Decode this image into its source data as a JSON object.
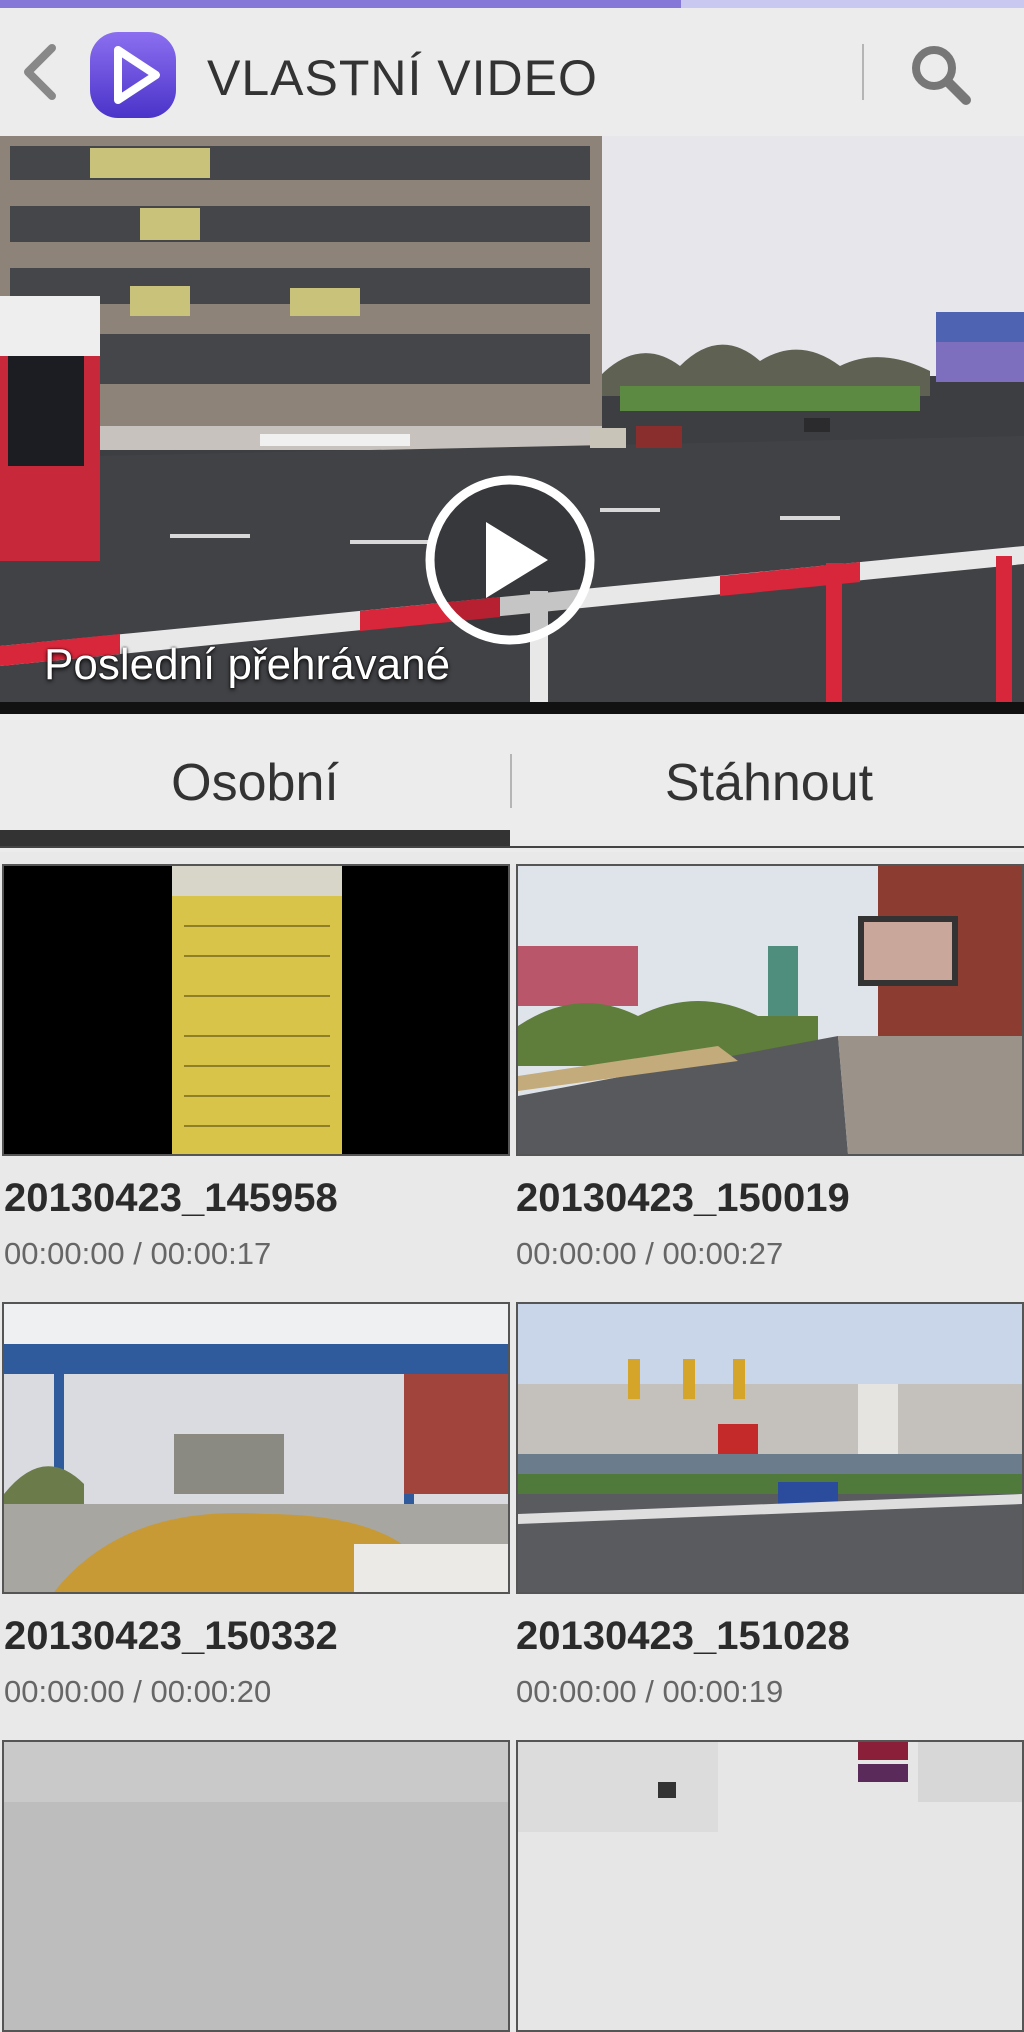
{
  "theme": {
    "accent": "#8577d8",
    "strip_track": "#c8c8f0",
    "background": "#e9e9e9",
    "logo_color": "#6a4fe3"
  },
  "top_strip": {
    "progress": 0.665
  },
  "action_bar": {
    "back_icon": "chevron-left-icon",
    "logo_icon": "video-player-logo-icon",
    "title": "VLASTNÍ VIDEO",
    "search_icon": "search-icon"
  },
  "hero": {
    "caption": "Poslední přehrávané",
    "play_icon": "play-circle-icon"
  },
  "tabs": [
    {
      "label": "Osobní",
      "selected": true
    },
    {
      "label": "Stáhnout",
      "selected": false
    }
  ],
  "videos": [
    {
      "title": "20130423_145958",
      "duration": "00:00:00 / 00:00:17"
    },
    {
      "title": "20130423_150019",
      "duration": "00:00:00 / 00:00:27"
    },
    {
      "title": "20130423_150332",
      "duration": "00:00:00 / 00:00:20"
    },
    {
      "title": "20130423_151028",
      "duration": "00:00:00 / 00:00:19"
    }
  ]
}
